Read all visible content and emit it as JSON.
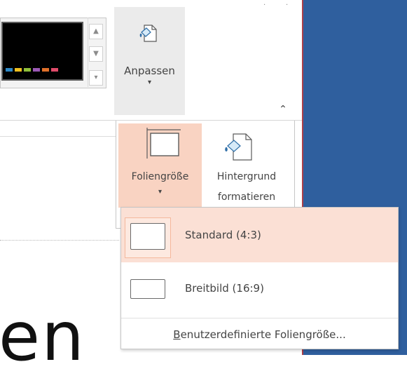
{
  "ribbon": {
    "customize_label": "Anpassen",
    "customize_arrow": "▾",
    "collapse_icon": "⌃",
    "theme_swatches": [
      "#2e88c6",
      "#f0c020",
      "#8fbf3b",
      "#9b59b6",
      "#e0702a",
      "#e04b6a"
    ],
    "gallery_up": "▲",
    "gallery_down": "▼",
    "gallery_more": "▾"
  },
  "flyout": {
    "slide_size_label": "Foliengröße",
    "slide_size_arrow": "▾",
    "format_background_line1": "Hintergrund",
    "format_background_line2": "formatieren"
  },
  "menu": {
    "standard_label": "Standard (4:3)",
    "widescreen_label": "Breitbild (16:9)",
    "custom_label_accel": "B",
    "custom_label_rest": "enutzerdefinierte Foliengröße..."
  },
  "slide": {
    "text": "en"
  },
  "colors": {
    "accent_highlight": "#f9d3c2",
    "menu_selected": "#fbe0d5",
    "right_pane": "#2f5f9e"
  }
}
